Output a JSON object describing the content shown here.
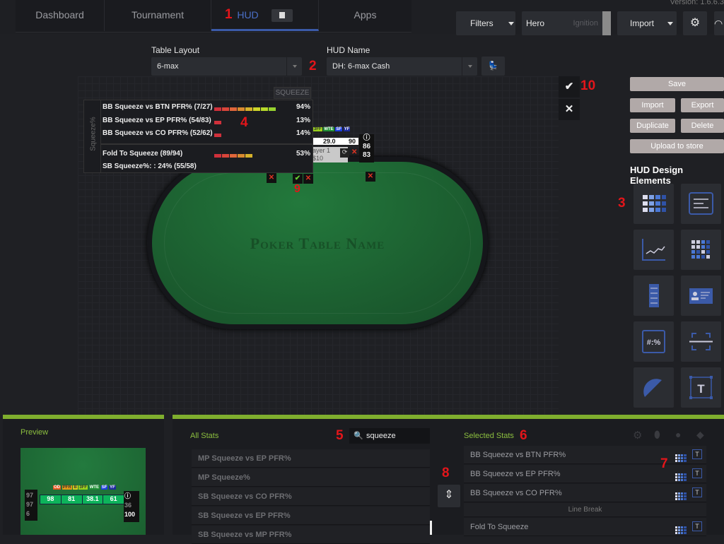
{
  "nav": {
    "tabs": [
      {
        "label": "Dashboard"
      },
      {
        "label": "Tournament"
      },
      {
        "label": "HUD"
      },
      {
        "label": "Apps"
      }
    ],
    "active": "HUD"
  },
  "version": "Version: 1.6.6.3",
  "toolbar": {
    "filters": "Filters",
    "hero": "Hero",
    "site": "Ignition",
    "import": "Import"
  },
  "annotations": [
    "1",
    "2",
    "3",
    "4",
    "5",
    "6",
    "7",
    "8",
    "9",
    "10"
  ],
  "layout": {
    "table_layout_label": "Table Layout",
    "table_layout_value": "6-max",
    "hud_name_label": "HUD Name",
    "hud_name_value": "DH: 6-max Cash"
  },
  "table": {
    "name": "Poker Table Name"
  },
  "popup": {
    "tag": "SQUEEZE",
    "side_label": "Squeeze%",
    "rows": [
      {
        "name": "BB Squeeze vs BTN PFR% (7/27)",
        "pct": "94%",
        "fill": 0.94
      },
      {
        "name": "BB Squeeze vs EP PFR% (54/83)",
        "pct": "13%",
        "fill": 0.13
      },
      {
        "name": "BB Squeeze vs CO PFR% (52/62)",
        "pct": "14%",
        "fill": 0.14
      },
      {
        "name": "Fold To Squeeze (89/94)",
        "pct": "53%",
        "fill": 0.53
      }
    ],
    "footer": "SB Squeeze%: : 24%  (55/58)"
  },
  "seat_hud": {
    "badges": [
      "3FF",
      "WTE",
      "SF",
      "YF"
    ],
    "values": [
      "29.0",
      "90"
    ],
    "player": "ayer 1",
    "stack": "$10",
    "right": [
      "86",
      "83"
    ]
  },
  "actions": {
    "save": "Save",
    "import": "Import",
    "export": "Export",
    "duplicate": "Duplicate",
    "delete": "Delete",
    "upload": "Upload to store"
  },
  "design_elements_title": "HUD Design Elements",
  "preview": {
    "title": "Preview",
    "badges": [
      "OD",
      "PFR",
      "B",
      "3FF",
      "WTE",
      "SF",
      "YF"
    ],
    "cells": [
      "98",
      "81",
      "38.1",
      "61"
    ],
    "left": [
      "97",
      "97",
      "6"
    ],
    "right": [
      "36",
      "100"
    ]
  },
  "all_stats": {
    "title": "All Stats",
    "search": "squeeze",
    "items": [
      "MP Squeeze vs EP PFR%",
      "MP Squeeze%",
      "SB Squeeze vs CO PFR%",
      "SB Squeeze vs EP PFR%",
      "SB Squeeze vs MP PFR%"
    ]
  },
  "selected_stats": {
    "title": "Selected Stats",
    "items": [
      "BB Squeeze vs BTN PFR%",
      "BB Squeeze vs EP PFR%",
      "BB Squeeze vs CO PFR%",
      "Line Break",
      "Fold To Squeeze"
    ],
    "t_label": "T"
  }
}
